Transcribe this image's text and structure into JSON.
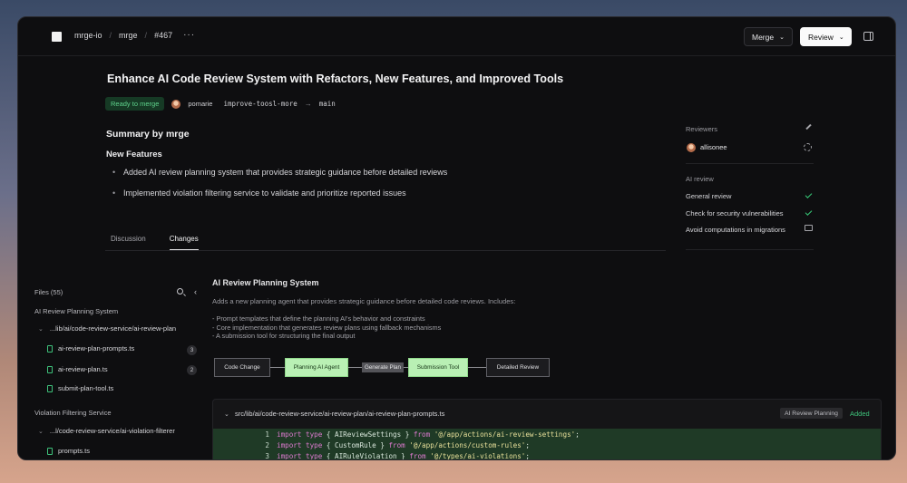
{
  "header": {
    "breadcrumbs": [
      "mrge-io",
      "mrge",
      "#467"
    ],
    "more": "···",
    "merge_label": "Merge",
    "review_label": "Review"
  },
  "pr": {
    "title": "Enhance AI Code Review System with Refactors, New Features, and Improved Tools",
    "status": "Ready to merge",
    "author": "pomarie",
    "source_branch": "improve-toosl-more",
    "target_branch": "main",
    "arrow": "→"
  },
  "summary": {
    "heading": "Summary by mrge",
    "subheading": "New Features",
    "bullets": [
      "Added AI review planning system that provides strategic guidance before detailed reviews",
      "Implemented violation filtering service to validate and prioritize reported issues"
    ]
  },
  "tabs": [
    "Discussion",
    "Changes"
  ],
  "sidebar": {
    "reviewers_label": "Reviewers",
    "reviewer": "allisonee",
    "ai_review_label": "AI review",
    "checks": [
      {
        "label": "General review",
        "status": "passed"
      },
      {
        "label": "Check for security vulnerabilities",
        "status": "passed"
      },
      {
        "label": "Avoid computations in migrations",
        "status": "comment"
      }
    ]
  },
  "files": {
    "heading": "Files (55)",
    "groups": [
      {
        "name": "AI Review Planning System",
        "folder": "...lib/ai/code-review-service/ai-review-plan",
        "files": [
          {
            "name": "ai-review-plan-prompts.ts",
            "count": "3"
          },
          {
            "name": "ai-review-plan.ts",
            "count": "2"
          },
          {
            "name": "submit-plan-tool.ts",
            "count": ""
          }
        ]
      },
      {
        "name": "Violation Filtering Service",
        "folder": "...l/code-review-service/ai-violation-filterer",
        "files": [
          {
            "name": "prompts.ts",
            "count": ""
          }
        ]
      }
    ]
  },
  "section": {
    "title": "AI Review Planning System",
    "description": "Adds a new planning agent that provides strategic guidance before detailed code reviews. Includes:",
    "list": [
      "- Prompt templates that define the planning AI's behavior and constraints",
      "- Core implementation that generates review plans using fallback mechanisms",
      "- A submission tool for structuring the final output"
    ]
  },
  "flow": {
    "nodes": [
      "Code Change",
      "Planning AI Agent",
      "Submission Tool",
      "Detailed Review"
    ],
    "edge_label": "Generate Plan"
  },
  "diff": {
    "path": "src/lib/ai/code-review-service/ai-review-plan/ai-review-plan-prompts.ts",
    "tag": "AI Review Planning",
    "status": "Added",
    "lines": [
      {
        "num": "1",
        "kw1": "import",
        "kw2": "type",
        "body": " { AIReviewSettings } ",
        "from": "from",
        "str": "'@/app/actions/ai-review-settings'",
        "end": ";"
      },
      {
        "num": "2",
        "kw1": "import",
        "kw2": "type",
        "body": " { CustomRule } ",
        "from": "from",
        "str": "'@/app/actions/custom-rules'",
        "end": ";"
      },
      {
        "num": "3",
        "kw1": "import",
        "kw2": "type",
        "body": " { AIRuleViolation } ",
        "from": "from",
        "str": "'@/types/ai-violations'",
        "end": ";"
      }
    ]
  },
  "colors": {
    "accent_green": "#3ec27b",
    "node_green": "#b9f0b4",
    "background": "#0e0e10"
  }
}
